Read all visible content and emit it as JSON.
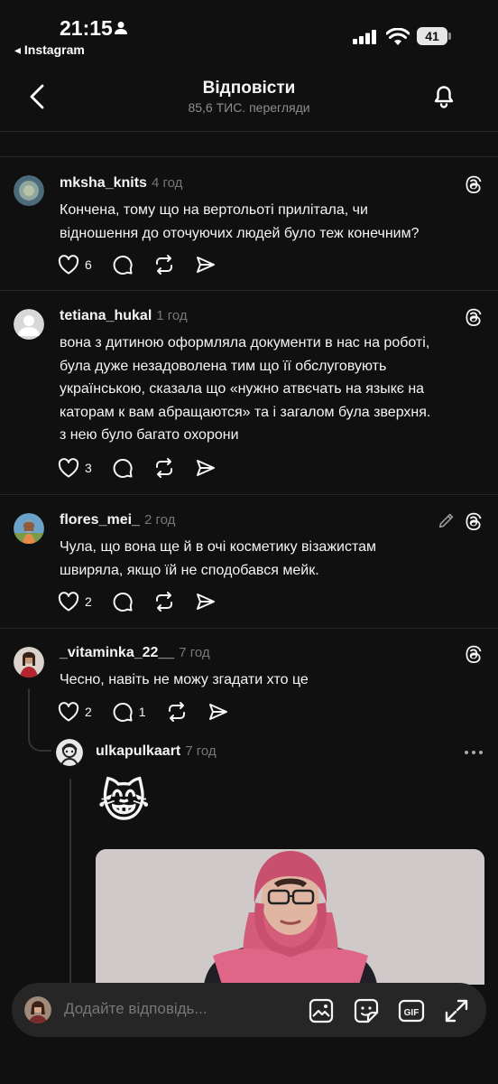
{
  "status_bar": {
    "time": "21:15",
    "back_app": "◂ Instagram",
    "battery": "41"
  },
  "header": {
    "title": "Відповісти",
    "subtitle": "85,6 ТИС. перегляди"
  },
  "comments": [
    {
      "username": "mksha_knits",
      "time": "4 год",
      "lines": [
        "Кончена, тому що на вертольоті прилітала, чи",
        "відношення до оточуючих людей було теж конечним?"
      ],
      "likes": "6"
    },
    {
      "username": "tetiana_hukal",
      "time": "1 год",
      "lines": [
        "вона з дитиною оформляла документи в нас на роботі,",
        "була дуже незадоволена тим що її обслуговують",
        "українською, сказала що «нужно атвєчать на языкє на",
        "каторам к вам абращаются» та і загалом була зверхня.",
        "з нею було багато охорони"
      ],
      "likes": "3"
    },
    {
      "username": "flores_mei_",
      "time": "2 год",
      "lines": [
        "Чула, що вона ще й в очі косметику візажистам",
        "швиряла, якщо їй не сподобався мейк."
      ],
      "likes": "2"
    },
    {
      "username": "_vitaminka_22__",
      "time": "7 год",
      "lines": [
        "Чесно, навіть не можу згадати хто це"
      ],
      "likes": "2",
      "replies": "1"
    }
  ],
  "nested_reply": {
    "username": "ulkapulkaart",
    "time": "7 год",
    "emoji": "😹"
  },
  "reply_bar": {
    "placeholder": "Додайте відповідь..."
  }
}
